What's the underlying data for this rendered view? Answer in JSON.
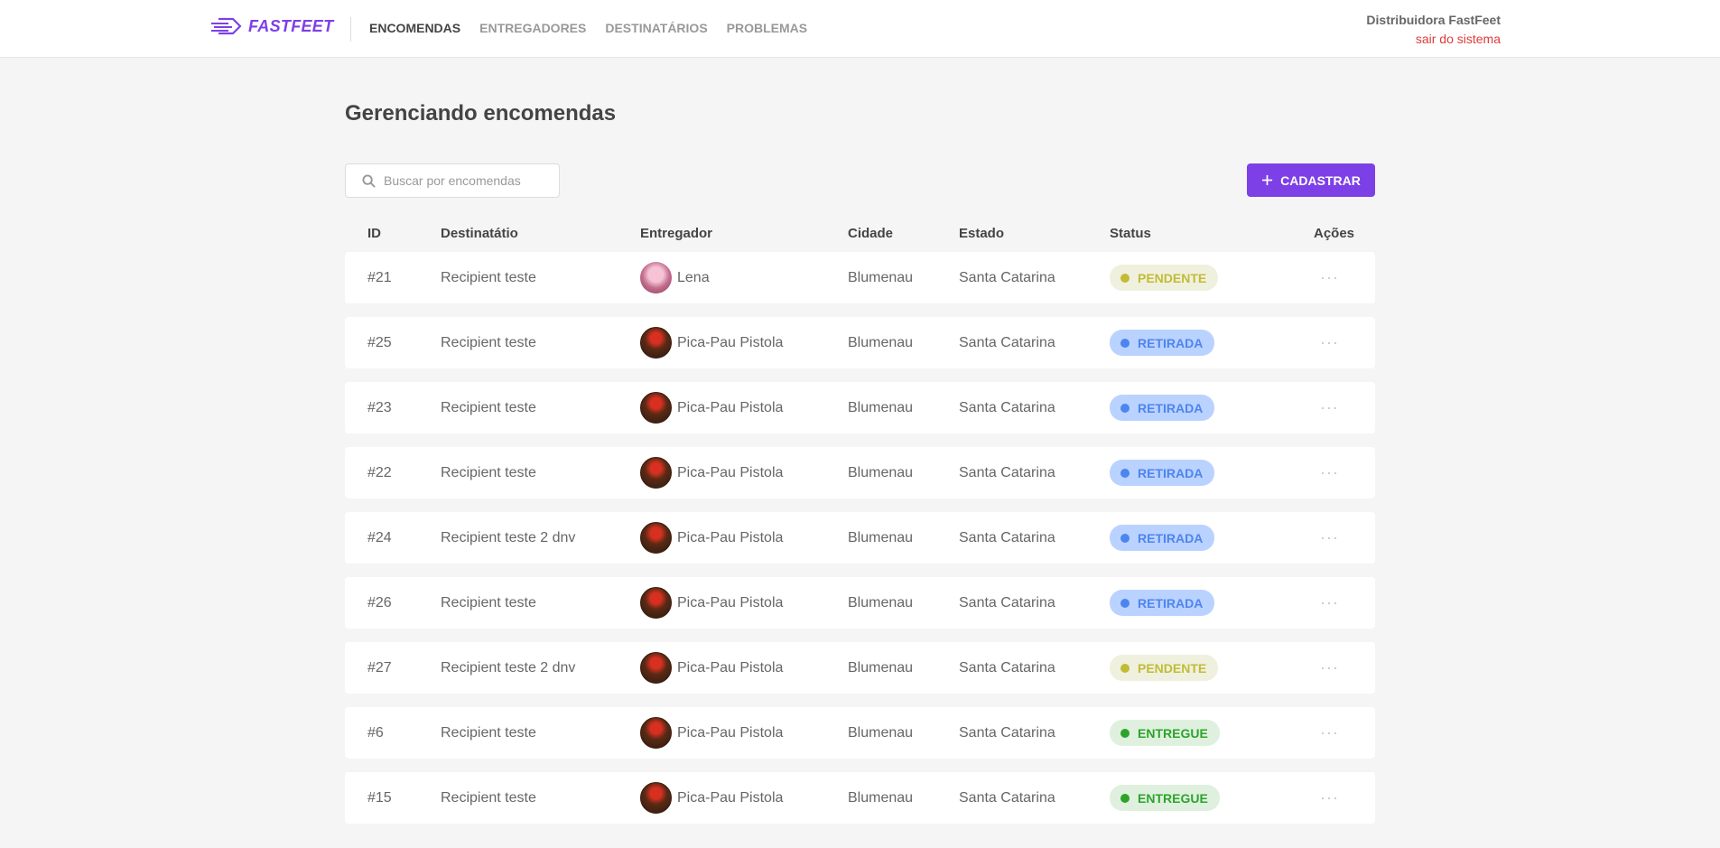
{
  "brand": {
    "name": "FASTFEET",
    "accent": "#7d40e7"
  },
  "nav": [
    {
      "label": "ENCOMENDAS",
      "active": true
    },
    {
      "label": "ENTREGADORES",
      "active": false
    },
    {
      "label": "DESTINATÁRIOS",
      "active": false
    },
    {
      "label": "PROBLEMAS",
      "active": false
    }
  ],
  "profile": {
    "name": "Distribuidora FastFeet",
    "logout": "sair do sistema"
  },
  "page": {
    "title": "Gerenciando encomendas"
  },
  "search": {
    "placeholder": "Buscar por encomendas",
    "icon": "search-icon"
  },
  "add_button": {
    "label": "CADASTRAR",
    "icon": "plus-icon"
  },
  "table": {
    "headers": [
      "ID",
      "Destinatátio",
      "Entregador",
      "Cidade",
      "Estado",
      "Status",
      "Ações"
    ],
    "rows": [
      {
        "id": "#21",
        "recipient": "Recipient teste",
        "deliveryman": "Lena",
        "avatar": "lena",
        "city": "Blumenau",
        "state": "Santa Catarina",
        "status": "PENDENTE",
        "status_key": "pendente",
        "actions": "···"
      },
      {
        "id": "#25",
        "recipient": "Recipient teste",
        "deliveryman": "Pica-Pau Pistola",
        "avatar": "pica",
        "city": "Blumenau",
        "state": "Santa Catarina",
        "status": "RETIRADA",
        "status_key": "retirada",
        "actions": "···"
      },
      {
        "id": "#23",
        "recipient": "Recipient teste",
        "deliveryman": "Pica-Pau Pistola",
        "avatar": "pica",
        "city": "Blumenau",
        "state": "Santa Catarina",
        "status": "RETIRADA",
        "status_key": "retirada",
        "actions": "···"
      },
      {
        "id": "#22",
        "recipient": "Recipient teste",
        "deliveryman": "Pica-Pau Pistola",
        "avatar": "pica",
        "city": "Blumenau",
        "state": "Santa Catarina",
        "status": "RETIRADA",
        "status_key": "retirada",
        "actions": "···"
      },
      {
        "id": "#24",
        "recipient": "Recipient teste 2 dnv",
        "deliveryman": "Pica-Pau Pistola",
        "avatar": "pica",
        "city": "Blumenau",
        "state": "Santa Catarina",
        "status": "RETIRADA",
        "status_key": "retirada",
        "actions": "···"
      },
      {
        "id": "#26",
        "recipient": "Recipient teste",
        "deliveryman": "Pica-Pau Pistola",
        "avatar": "pica",
        "city": "Blumenau",
        "state": "Santa Catarina",
        "status": "RETIRADA",
        "status_key": "retirada",
        "actions": "···"
      },
      {
        "id": "#27",
        "recipient": "Recipient teste 2 dnv",
        "deliveryman": "Pica-Pau Pistola",
        "avatar": "pica",
        "city": "Blumenau",
        "state": "Santa Catarina",
        "status": "PENDENTE",
        "status_key": "pendente",
        "actions": "···"
      },
      {
        "id": "#6",
        "recipient": "Recipient teste",
        "deliveryman": "Pica-Pau Pistola",
        "avatar": "pica",
        "city": "Blumenau",
        "state": "Santa Catarina",
        "status": "ENTREGUE",
        "status_key": "entregue",
        "actions": "···"
      },
      {
        "id": "#15",
        "recipient": "Recipient teste",
        "deliveryman": "Pica-Pau Pistola",
        "avatar": "pica",
        "city": "Blumenau",
        "state": "Santa Catarina",
        "status": "ENTREGUE",
        "status_key": "entregue",
        "actions": "···"
      }
    ]
  }
}
